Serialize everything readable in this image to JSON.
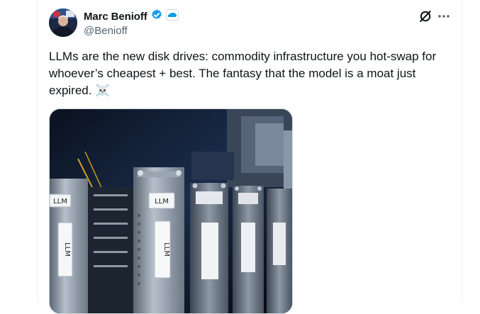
{
  "author": {
    "display_name": "Marc Benioff",
    "handle": "@Benioff",
    "verified_icon": "verified-badge-icon",
    "affiliate_badge_icon": "salesforce-cloud-icon"
  },
  "header_actions": {
    "grok_icon": "grok-icon",
    "more_icon": "more-options-icon"
  },
  "tweet": {
    "text": "LLMs are the new disk drives: commodity infrastructure you hot-swap for whoever’s cheapest + best. The fantasy that the model is a moat just expired. ☠️"
  },
  "media": {
    "drive_labels": [
      "LLM",
      "LLM",
      "LLM",
      "LLM"
    ]
  },
  "colors": {
    "verified_blue": "#1d9bf0",
    "text_primary": "#0f1419",
    "text_secondary": "#536471"
  }
}
